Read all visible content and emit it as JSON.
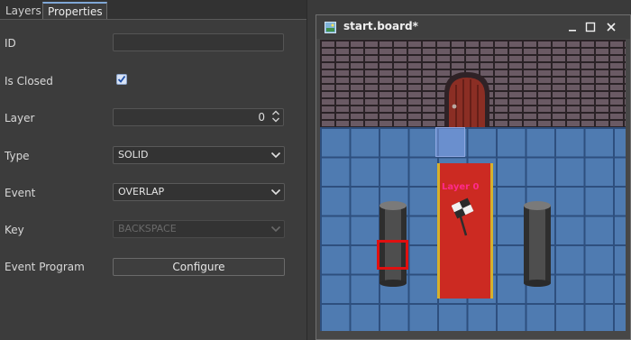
{
  "tabs": [
    {
      "label": "Layers",
      "active": false
    },
    {
      "label": "Properties",
      "active": true
    }
  ],
  "properties": {
    "id": {
      "label": "ID",
      "value": ""
    },
    "is_closed": {
      "label": "Is Closed",
      "checked": true
    },
    "layer": {
      "label": "Layer",
      "value": "0"
    },
    "type": {
      "label": "Type",
      "value": "SOLID"
    },
    "event": {
      "label": "Event",
      "value": "OVERLAP"
    },
    "key": {
      "label": "Key",
      "value": "BACKSPACE",
      "disabled": true
    },
    "event_program": {
      "label": "Event Program",
      "button_label": "Configure"
    }
  },
  "window": {
    "title": "start.board*",
    "icon": "board-file-icon",
    "controls": [
      "minimize-icon",
      "maximize-icon",
      "close-icon"
    ]
  },
  "board": {
    "carpet_label": "Layer 0"
  },
  "colors": {
    "accent_tab": "#7fa7d6",
    "selection": "#e01010",
    "carpet": "#cc2a22",
    "layer_label": "#ff2a8a"
  }
}
